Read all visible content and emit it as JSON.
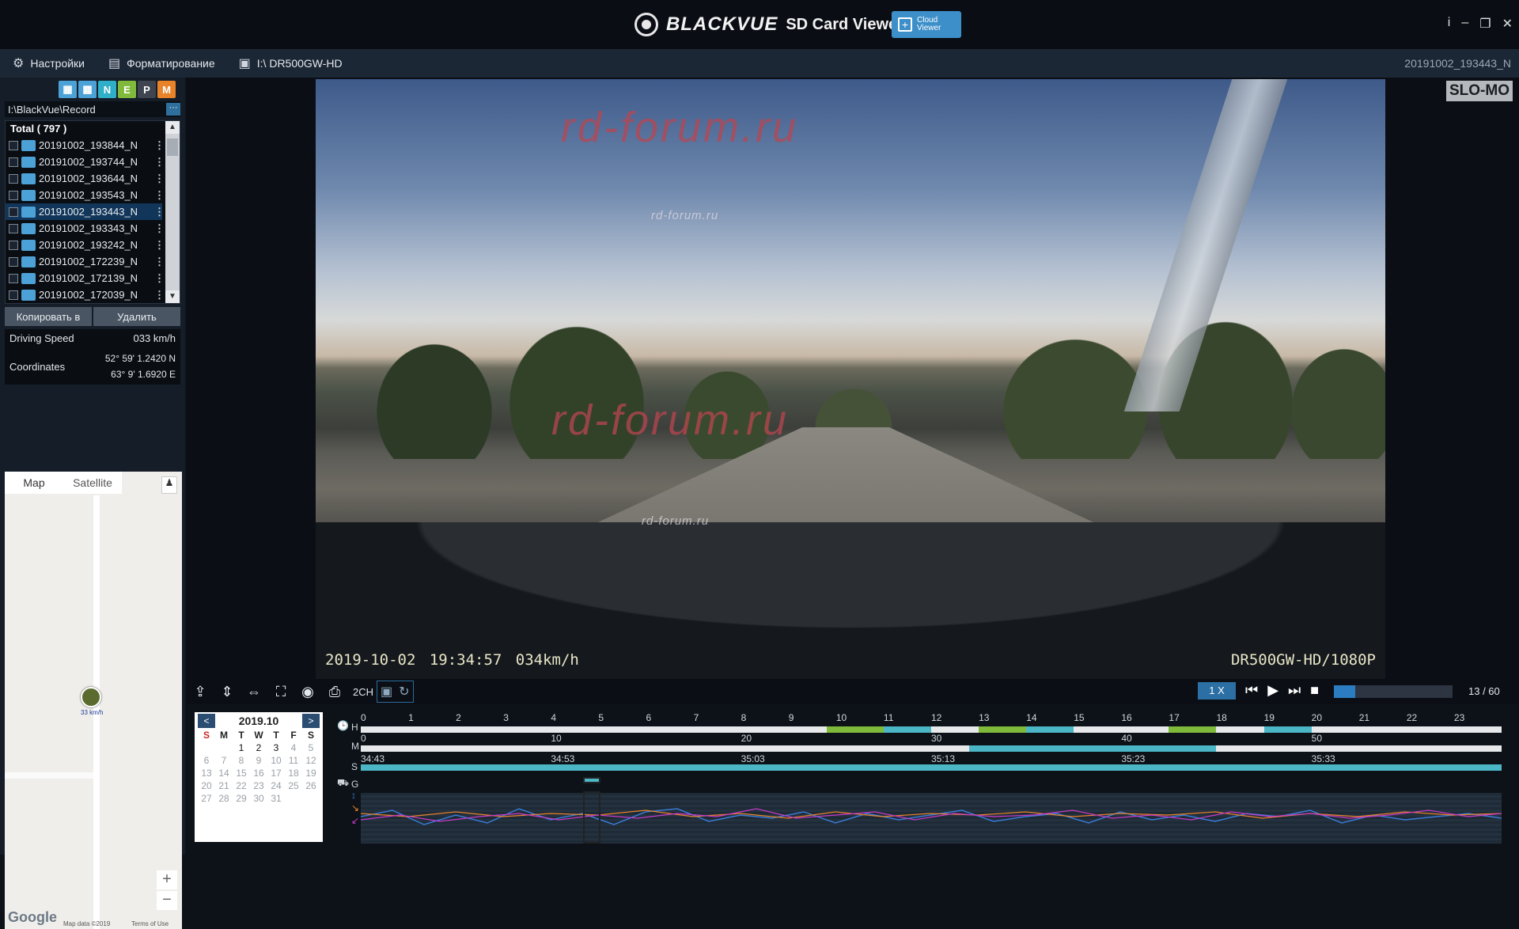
{
  "titlebar": {
    "brand": "BLACKVUE",
    "app_title": "SD Card Viewer",
    "cloud_btn": "Cloud Viewer",
    "controls": [
      "i",
      "–",
      "❐",
      "✕"
    ]
  },
  "menubar": {
    "settings": "Настройки",
    "format": "Форматирование",
    "drive": "I:\\ DR500GW-HD",
    "current_file": "20191002_193443_N"
  },
  "filters": {
    "n": "N",
    "e": "E",
    "p": "P",
    "m": "M",
    "colors": {
      "n": "#2fb0c8",
      "e": "#7fba3a",
      "p": "#3e4550",
      "m": "#e8832a",
      "icon": "#4ca2d6"
    }
  },
  "filelist": {
    "path": "I:\\BlackVue\\Record",
    "path_more": "···",
    "total": "Total ( 797 )",
    "files": [
      {
        "name": "20191002_193844_N",
        "selected": false
      },
      {
        "name": "20191002_193744_N",
        "selected": false
      },
      {
        "name": "20191002_193644_N",
        "selected": false
      },
      {
        "name": "20191002_193543_N",
        "selected": false
      },
      {
        "name": "20191002_193443_N",
        "selected": true
      },
      {
        "name": "20191002_193343_N",
        "selected": false
      },
      {
        "name": "20191002_193242_N",
        "selected": false
      },
      {
        "name": "20191002_172239_N",
        "selected": false
      },
      {
        "name": "20191002_172139_N",
        "selected": false
      },
      {
        "name": "20191002_172039_N",
        "selected": false
      }
    ],
    "copy_btn": "Копировать в",
    "delete_btn": "Удалить"
  },
  "info": {
    "speed_label": "Driving Speed",
    "speed_value": "033 km/h",
    "coords_label": "Coordinates",
    "lat": "52° 59' 1.2420 N",
    "lon": "63° 9' 1.6920 E"
  },
  "map": {
    "tab_map": "Map",
    "tab_satellite": "Satellite",
    "marker_label": "33 km/h",
    "zoom_in": "+",
    "zoom_out": "−",
    "google": "Google",
    "attribution": "Map data ©2019",
    "terms": "Terms of Use"
  },
  "video": {
    "watermark": "rd-forum.ru",
    "timestamp": "2019-10-02 19:34:57",
    "speed": "034km/h",
    "model": "DR500GW-HD/1080P",
    "slomo": "SLO-MO"
  },
  "controls": {
    "ch_label": "2CH",
    "speed": "1 X",
    "frames": "13 / 60",
    "progress": 0.18
  },
  "calendar": {
    "title": "2019.10",
    "prev": "<",
    "next": ">",
    "weekdays": [
      "S",
      "M",
      "T",
      "W",
      "T",
      "F",
      "S"
    ],
    "days": [
      {
        "d": "",
        "rec": false
      },
      {
        "d": "",
        "rec": false
      },
      {
        "d": "1",
        "rec": true
      },
      {
        "d": "2",
        "rec": true
      },
      {
        "d": "3",
        "rec": true
      },
      {
        "d": "4",
        "rec": false
      },
      {
        "d": "5",
        "rec": false
      },
      {
        "d": "6",
        "rec": false
      },
      {
        "d": "7",
        "rec": false
      },
      {
        "d": "8",
        "rec": false
      },
      {
        "d": "9",
        "rec": false
      },
      {
        "d": "10",
        "rec": false
      },
      {
        "d": "11",
        "rec": false
      },
      {
        "d": "12",
        "rec": false
      },
      {
        "d": "13",
        "rec": false
      },
      {
        "d": "14",
        "rec": false
      },
      {
        "d": "15",
        "rec": false
      },
      {
        "d": "16",
        "rec": false
      },
      {
        "d": "17",
        "rec": false
      },
      {
        "d": "18",
        "rec": false
      },
      {
        "d": "19",
        "rec": false
      },
      {
        "d": "20",
        "rec": false
      },
      {
        "d": "21",
        "rec": false
      },
      {
        "d": "22",
        "rec": false
      },
      {
        "d": "23",
        "rec": false
      },
      {
        "d": "24",
        "rec": false
      },
      {
        "d": "25",
        "rec": false
      },
      {
        "d": "26",
        "rec": false
      },
      {
        "d": "27",
        "rec": false
      },
      {
        "d": "28",
        "rec": false
      },
      {
        "d": "29",
        "rec": false
      },
      {
        "d": "30",
        "rec": false
      },
      {
        "d": "31",
        "rec": false
      }
    ]
  },
  "timeline": {
    "h_label": "H",
    "m_label": "M",
    "s_label": "S",
    "g_label": "G",
    "hours": [
      "0",
      "1",
      "2",
      "3",
      "4",
      "5",
      "6",
      "7",
      "8",
      "9",
      "10",
      "11",
      "12",
      "13",
      "14",
      "15",
      "16",
      "17",
      "18",
      "19",
      "20",
      "21",
      "22",
      "23"
    ],
    "minutes": [
      "0",
      "10",
      "20",
      "30",
      "40",
      "50"
    ],
    "seconds": [
      "34:43",
      "34:53",
      "35:03",
      "35:13",
      "35:23",
      "35:33"
    ],
    "colors": {
      "normal": "#4ab6c6",
      "event": "#7fba3a"
    }
  }
}
